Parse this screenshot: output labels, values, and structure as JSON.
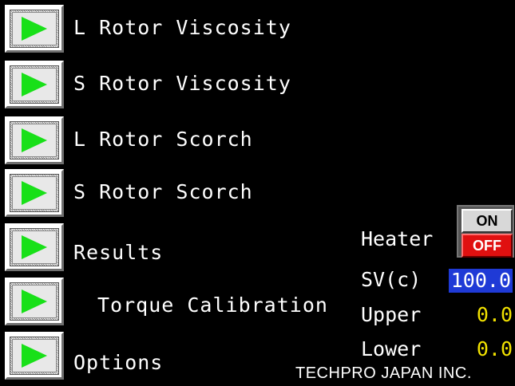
{
  "menu": {
    "items": [
      {
        "label": "L Rotor Viscosity",
        "icon": "play-icon"
      },
      {
        "label": "S Rotor Viscosity",
        "icon": "play-icon"
      },
      {
        "label": "L Rotor Scorch",
        "icon": "play-icon"
      },
      {
        "label": "S Rotor Scorch",
        "icon": "play-icon"
      },
      {
        "label": "Results",
        "icon": "play-icon"
      },
      {
        "label": "Torque Calibration",
        "icon": "play-icon"
      },
      {
        "label": "Options",
        "icon": "play-icon"
      }
    ]
  },
  "status": {
    "heater_label": "Heater",
    "heater_on_label": "ON",
    "heater_off_label": "OFF",
    "sv_label": "SV(c)",
    "sv_value": "100.0",
    "upper_label": "Upper",
    "upper_value": "0.0",
    "lower_label": "Lower",
    "lower_value": "0.0"
  },
  "footer": {
    "company": "TECHPRO JAPAN INC."
  },
  "colors": {
    "background": "#000000",
    "play_green": "#18e018",
    "value_yellow": "#f2e200",
    "sv_highlight": "#1f3ad6",
    "off_red": "#e01010"
  }
}
